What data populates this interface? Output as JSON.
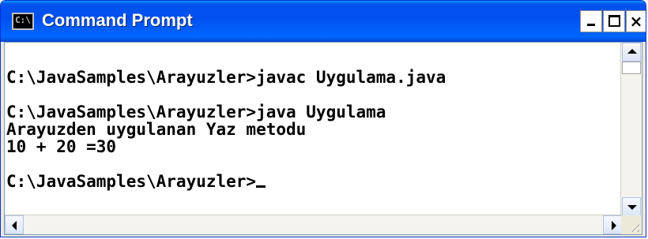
{
  "window": {
    "title": "Command Prompt",
    "title_icon_text": "C:\\",
    "buttons": {
      "minimize": "minimize",
      "maximize": "maximize",
      "close": "×"
    }
  },
  "console": {
    "lines": [
      "C:\\JavaSamples\\Arayuzler>javac Uygulama.java",
      "",
      "C:\\JavaSamples\\Arayuzler>java Uygulama",
      "Arayuzden uygulanan Yaz metodu",
      "10 + 20 =30",
      "",
      "C:\\JavaSamples\\Arayuzler>"
    ]
  },
  "colors": {
    "titlebar": "#0054e3",
    "console_background": "#ffffff",
    "console_text": "#000000"
  },
  "icons": {
    "app": "console-app-icon",
    "scroll_up": "arrow-up-icon",
    "scroll_down": "arrow-down-icon",
    "scroll_left": "arrow-left-icon",
    "scroll_right": "arrow-right-icon",
    "resize": "resize-grip-icon"
  }
}
